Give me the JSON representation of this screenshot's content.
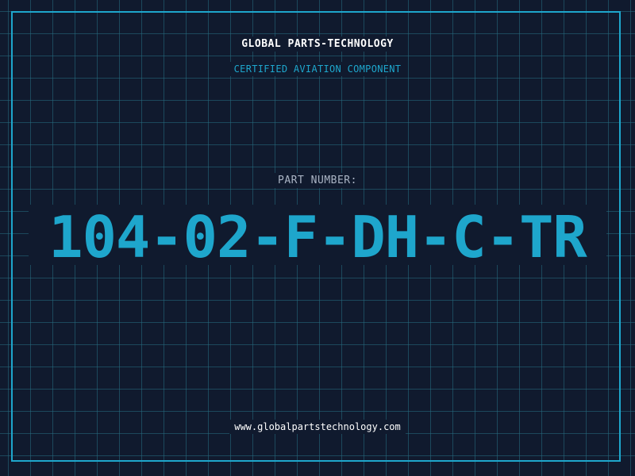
{
  "header": {
    "company": "GLOBAL PARTS-TECHNOLOGY",
    "subtitle": "CERTIFIED AVIATION COMPONENT"
  },
  "part": {
    "label": "PART NUMBER:",
    "number": "104-02-F-DH-C-TR"
  },
  "footer": {
    "url": "www.globalpartstechnology.com"
  },
  "colors": {
    "background": "#101a2e",
    "accent": "#1ea6cc",
    "grid": "#266e82",
    "text": "#ffffff",
    "label": "#aab4c4"
  }
}
